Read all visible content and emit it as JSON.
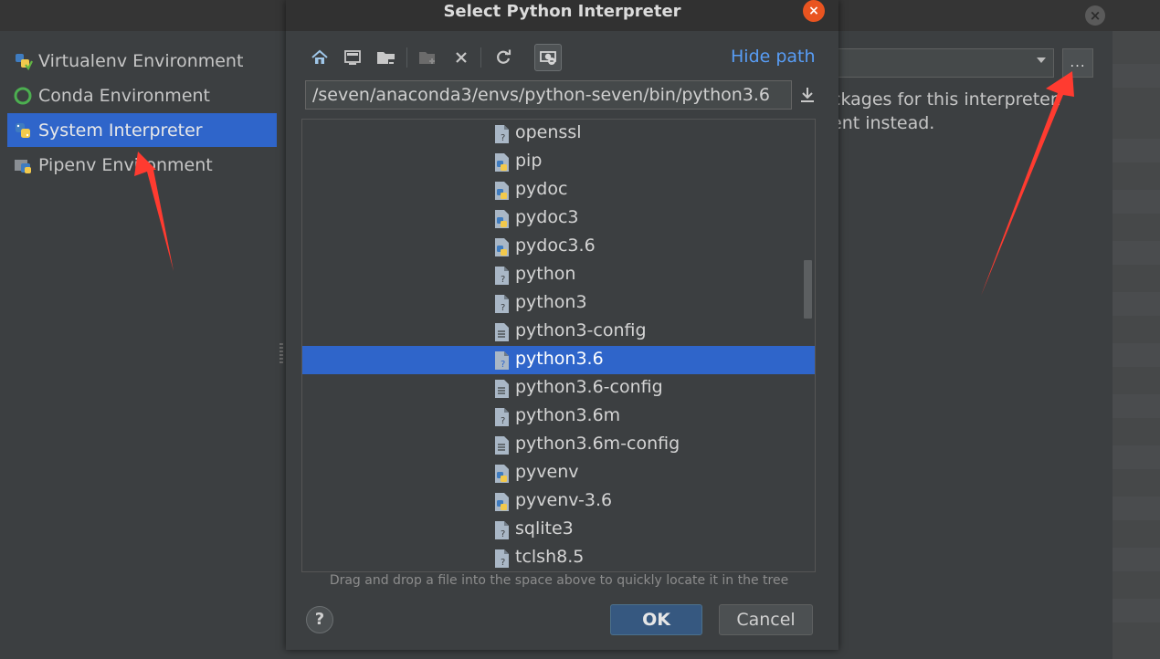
{
  "background_window": {
    "sidebar_items": [
      {
        "label": "Virtualenv Environment",
        "icon": "virtualenv-icon"
      },
      {
        "label": "Conda Environment",
        "icon": "conda-ring-icon"
      },
      {
        "label": "System Interpreter",
        "icon": "python-icon",
        "selected": true
      },
      {
        "label": "Pipenv Environment",
        "icon": "pipenv-icon"
      }
    ],
    "browse_label": "...",
    "message_line1": "ckages for this interpreter.",
    "message_line2": "ent instead."
  },
  "dialog": {
    "title": "Select Python Interpreter",
    "hide_path_label": "Hide path",
    "path_value": "/seven/anaconda3/envs/python-seven/bin/python3.6",
    "toolbar": [
      {
        "name": "home-icon",
        "enabled": true
      },
      {
        "name": "desktop-icon",
        "enabled": true
      },
      {
        "name": "project-folder-icon",
        "enabled": true
      },
      {
        "name": "new-folder-icon",
        "enabled": false
      },
      {
        "name": "delete-icon",
        "enabled": true
      },
      {
        "name": "refresh-icon",
        "enabled": true
      },
      {
        "name": "show-hidden-icon",
        "enabled": true,
        "active": true
      }
    ],
    "files": [
      {
        "name": "openssl"
      },
      {
        "name": "pip"
      },
      {
        "name": "pydoc"
      },
      {
        "name": "pydoc3"
      },
      {
        "name": "pydoc3.6"
      },
      {
        "name": "python"
      },
      {
        "name": "python3"
      },
      {
        "name": "python3-config"
      },
      {
        "name": "python3.6",
        "selected": true
      },
      {
        "name": "python3.6-config"
      },
      {
        "name": "python3.6m"
      },
      {
        "name": "python3.6m-config"
      },
      {
        "name": "pyvenv"
      },
      {
        "name": "pyvenv-3.6"
      },
      {
        "name": "sqlite3"
      },
      {
        "name": "tclsh8.5"
      }
    ],
    "hint": "Drag and drop a file into the space above to quickly locate it in the tree",
    "help_label": "?",
    "ok_label": "OK",
    "cancel_label": "Cancel"
  },
  "colors": {
    "selection": "#2f65ca",
    "link": "#589df6",
    "annotation_arrow": "#ff3b30",
    "close_button": "#e95420"
  }
}
